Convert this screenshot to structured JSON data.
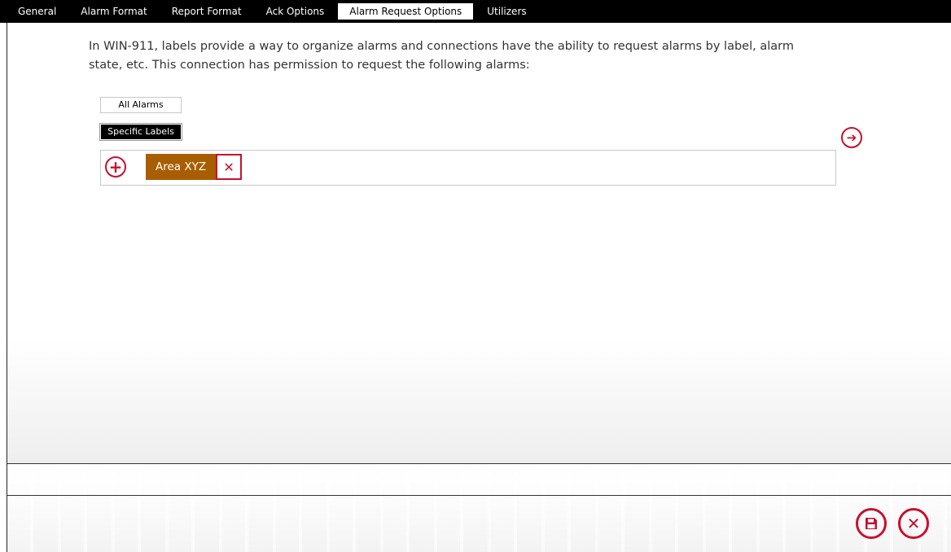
{
  "tabs": [
    {
      "label": "General",
      "active": false
    },
    {
      "label": "Alarm Format",
      "active": false
    },
    {
      "label": "Report Format",
      "active": false
    },
    {
      "label": "Ack Options",
      "active": false
    },
    {
      "label": "Alarm Request Options",
      "active": true
    },
    {
      "label": "Utilizers",
      "active": false
    }
  ],
  "main": {
    "description": "In WIN-911, labels provide a way to organize alarms and connections have the ability to request alarms by label, alarm state, etc. This connection has permission to request the following alarms:",
    "all_alarms_label": "All Alarms",
    "specific_labels_label": "Specific Labels",
    "selected_mode": "Specific Labels",
    "labels": [
      {
        "name": "Area XYZ"
      }
    ],
    "icons": {
      "add": "plus-circle-icon",
      "remove": "x-icon",
      "next": "arrow-right-circle-icon"
    }
  },
  "footer": {
    "icons": {
      "save": "floppy-disk-icon",
      "close": "x-circle-icon"
    }
  },
  "colors": {
    "accent": "#c8102e",
    "chip": "#a85e00",
    "tabbar": "#000000"
  }
}
